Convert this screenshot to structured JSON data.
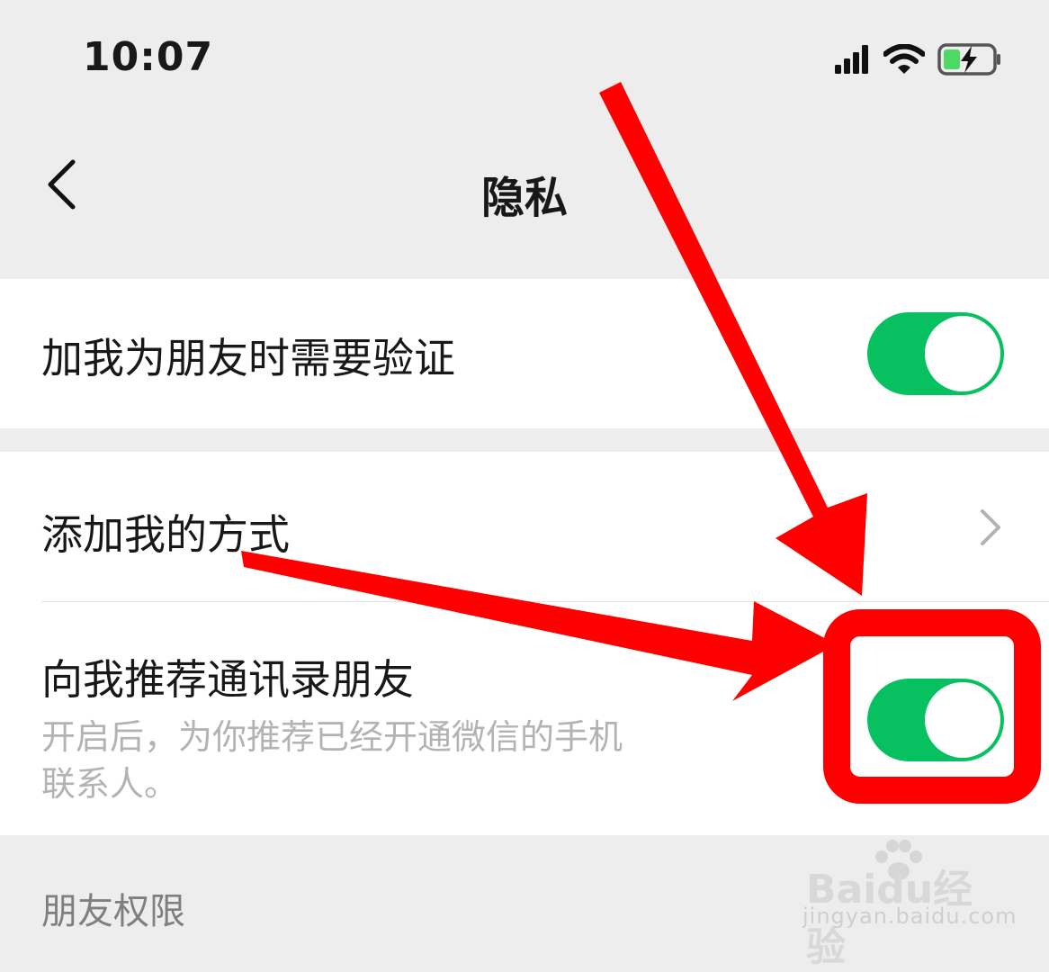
{
  "status_bar": {
    "time": "10:07",
    "icons": [
      "signal-icon",
      "wifi-icon",
      "battery-charging-icon"
    ]
  },
  "nav": {
    "title": "隐私",
    "back_icon": "chevron-left-icon"
  },
  "settings": {
    "verify_friend": {
      "label": "加我为朋友时需要验证",
      "enabled": true
    },
    "add_me_ways": {
      "label": "添加我的方式",
      "icon": "chevron-right-icon"
    },
    "recommend_contacts": {
      "label": "向我推荐通讯录朋友",
      "description": "开启后，为你推荐已经开通微信的手机联系人。",
      "enabled": true
    }
  },
  "sections": {
    "friend_permissions": "朋友权限"
  },
  "colors": {
    "toggle_on": "#07c160",
    "annotation_red": "#ff0000",
    "background": "#ededed"
  },
  "watermark": {
    "brand": "Baidu经验",
    "url": "jingyan.baidu.com"
  }
}
